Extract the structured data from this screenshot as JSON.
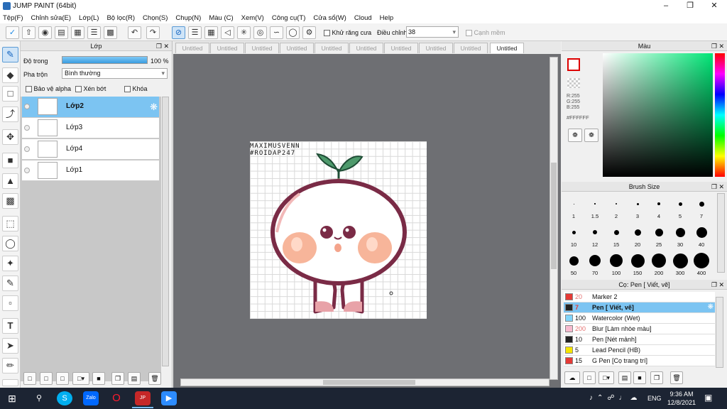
{
  "app": {
    "title": "JUMP PAINT (64bit)"
  },
  "menu": [
    "Tệp(F)",
    "Chỉnh sửa(E)",
    "Lớp(L)",
    "Bộ lọc(R)",
    "Chọn(S)",
    "Chụp(N)",
    "Màu (C)",
    "Xem(V)",
    "Công cụ(T)",
    "Cửa sổ(W)",
    "Cloud",
    "Help"
  ],
  "toolbar": {
    "antialias_label": "Khử răng cưa",
    "correction_label": "Điều chỉnh",
    "correction_value": "38",
    "snap_label": "Cạnh mềm"
  },
  "layers": {
    "title": "Lớp",
    "opacity_label": "Độ trong",
    "opacity_value": "100 %",
    "opacity": 1.0,
    "blend_label": "Pha trộn",
    "blend_value": "Bình thường",
    "protect_alpha": "Bảo vệ alpha",
    "clip": "Xén bớt",
    "lock": "Khóa",
    "items": [
      "Lớp2",
      "Lớp3",
      "Lớp4",
      "Lớp1"
    ]
  },
  "tabs": [
    "Untitled",
    "Untitled",
    "Untitled",
    "Untitled",
    "Untitled",
    "Untitled",
    "Untitled",
    "Untitled",
    "Untitled",
    "Untitled"
  ],
  "color": {
    "title": "Màu",
    "r": "R:255",
    "g": "G:255",
    "b": "B:255",
    "hex": "#FFFFFF"
  },
  "brush_size": {
    "title": "Brush Size",
    "sizes": [
      "1",
      "1.5",
      "2",
      "3",
      "4",
      "5",
      "7",
      "10",
      "12",
      "15",
      "20",
      "25",
      "30",
      "40",
      "50",
      "70",
      "100",
      "150",
      "200",
      "300",
      "400"
    ]
  },
  "brushes": {
    "title": "Cọ: Pen [ Viết, vẽ]",
    "items": [
      {
        "size": "20",
        "name": "Marker 2",
        "color": "#e53935"
      },
      {
        "size": "7",
        "name": "Pen [ Viết, vẽ]",
        "color": "#222222"
      },
      {
        "size": "100",
        "name": "Watercolor (Wet)",
        "color": "#81d4fa"
      },
      {
        "size": "200",
        "name": "Blur [Làm nhòe màu]",
        "color": "#f8bbd0"
      },
      {
        "size": "10",
        "name": "Pen [Nét mảnh]",
        "color": "#222222"
      },
      {
        "size": "5",
        "name": "Lead Pencil (HB)",
        "color": "#f5e400"
      },
      {
        "size": "15",
        "name": "G Pen [Cọ trang trí]",
        "color": "#e53935"
      }
    ]
  },
  "artwork": {
    "watermark_line1": "MAXIMUSVENN",
    "watermark_line2": "#ROIDAP247"
  },
  "taskbar": {
    "time": "9:36 AM",
    "date": "12/8/2021",
    "lang": "ENG"
  }
}
